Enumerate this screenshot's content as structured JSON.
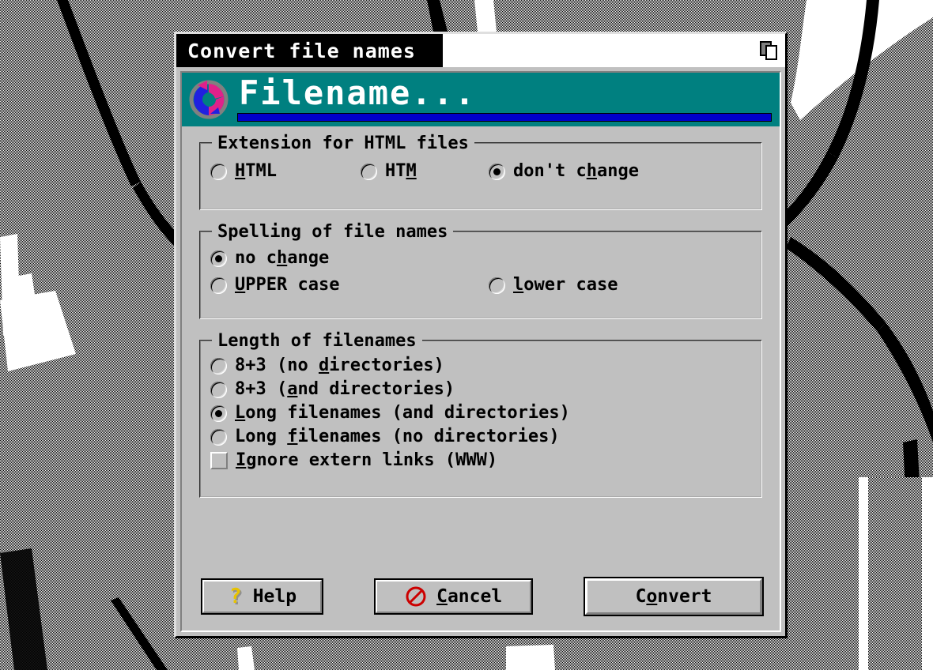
{
  "window": {
    "title": "Convert file names",
    "cascade_icon": "cascade-windows-icon"
  },
  "banner": {
    "icon": "convert-refresh-icon",
    "title": "Filename...",
    "accent_color": "#008080",
    "bar_color": "#0000cc"
  },
  "groups": [
    {
      "title": "Extension for HTML files",
      "type": "radio",
      "layout": "single-row",
      "options": [
        {
          "label": "HTML",
          "accel": "H",
          "accel_index": 0,
          "selected": false
        },
        {
          "label": "HTM",
          "accel": "M",
          "accel_index": 2,
          "selected": false
        },
        {
          "label": "don't change",
          "accel": "h",
          "accel_index": 7,
          "selected": true
        }
      ]
    },
    {
      "title": "Spelling of file names",
      "type": "radio",
      "layout": "two-column",
      "options": [
        {
          "label": "no change",
          "accel": "h",
          "accel_index": 4,
          "selected": true
        },
        {
          "label": "UPPER case",
          "accel": "U",
          "accel_index": 0,
          "selected": false
        },
        {
          "label": "lower case",
          "accel": "l",
          "accel_index": 0,
          "selected": false
        }
      ]
    },
    {
      "title": "Length of filenames",
      "type": "mixed",
      "layout": "stacked",
      "options": [
        {
          "control": "radio",
          "label": "8+3 (no directories)",
          "accel": "d",
          "accel_index": 8,
          "selected": false
        },
        {
          "control": "radio",
          "label": "8+3 (and directories)",
          "accel": "a",
          "accel_index": 5,
          "selected": false
        },
        {
          "control": "radio",
          "label": "Long filenames (and directories)",
          "accel": "L",
          "accel_index": 0,
          "selected": true
        },
        {
          "control": "radio",
          "label": "Long filenames (no directories)",
          "accel": "f",
          "accel_index": 5,
          "selected": false
        },
        {
          "control": "checkbox",
          "label": "Ignore extern links (WWW)",
          "accel": "I",
          "accel_index": 0,
          "selected": false
        }
      ]
    }
  ],
  "buttons": [
    {
      "name": "help",
      "label": "Help",
      "icon": "question-mark-icon",
      "accel": null,
      "accel_index": -1,
      "default": false
    },
    {
      "name": "cancel",
      "label": "Cancel",
      "icon": "no-entry-icon",
      "accel": "C",
      "accel_index": 0,
      "default": false
    },
    {
      "name": "convert",
      "label": "Convert",
      "icon": null,
      "accel": "o",
      "accel_index": 2,
      "default": true
    }
  ]
}
